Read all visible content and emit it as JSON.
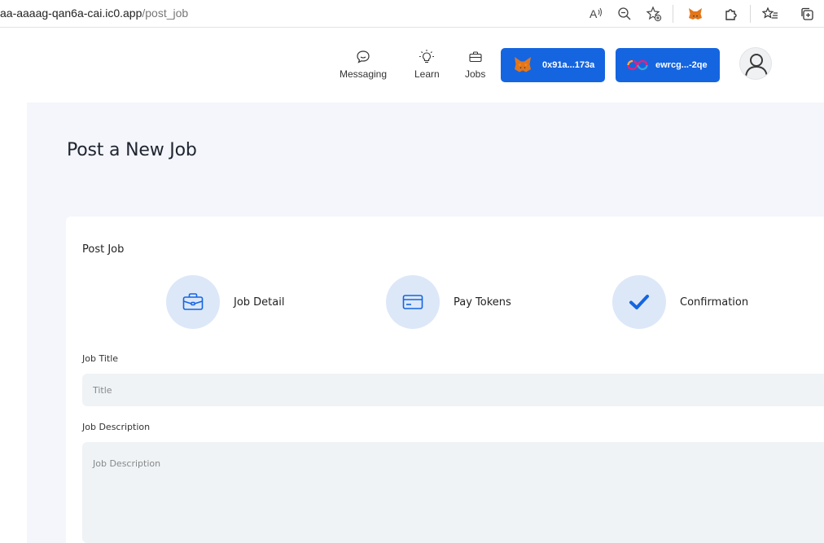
{
  "browser": {
    "url_host": "aa-aaaag-qan6a-cai.ic0.app",
    "url_path": "/post_job"
  },
  "nav": {
    "messaging": "Messaging",
    "learn": "Learn",
    "jobs": "Jobs"
  },
  "wallets": {
    "metamask_address": "0x91a...173a",
    "icp_principal": "ewrcg...-2qe"
  },
  "page": {
    "title": "Post a New Job"
  },
  "form": {
    "heading": "Post Job",
    "steps": [
      {
        "label": "Job Detail",
        "icon": "briefcase-icon"
      },
      {
        "label": "Pay Tokens",
        "icon": "card-icon"
      },
      {
        "label": "Confirmation",
        "icon": "check-icon"
      }
    ],
    "job_title_label": "Job Title",
    "job_title_placeholder": "Title",
    "job_description_label": "Job Description",
    "job_description_placeholder": "Job Description"
  },
  "colors": {
    "accent": "#1565e0",
    "step_circle": "#dce8f8",
    "page_bg": "#f4f6fb",
    "input_bg": "#eff3f6"
  }
}
